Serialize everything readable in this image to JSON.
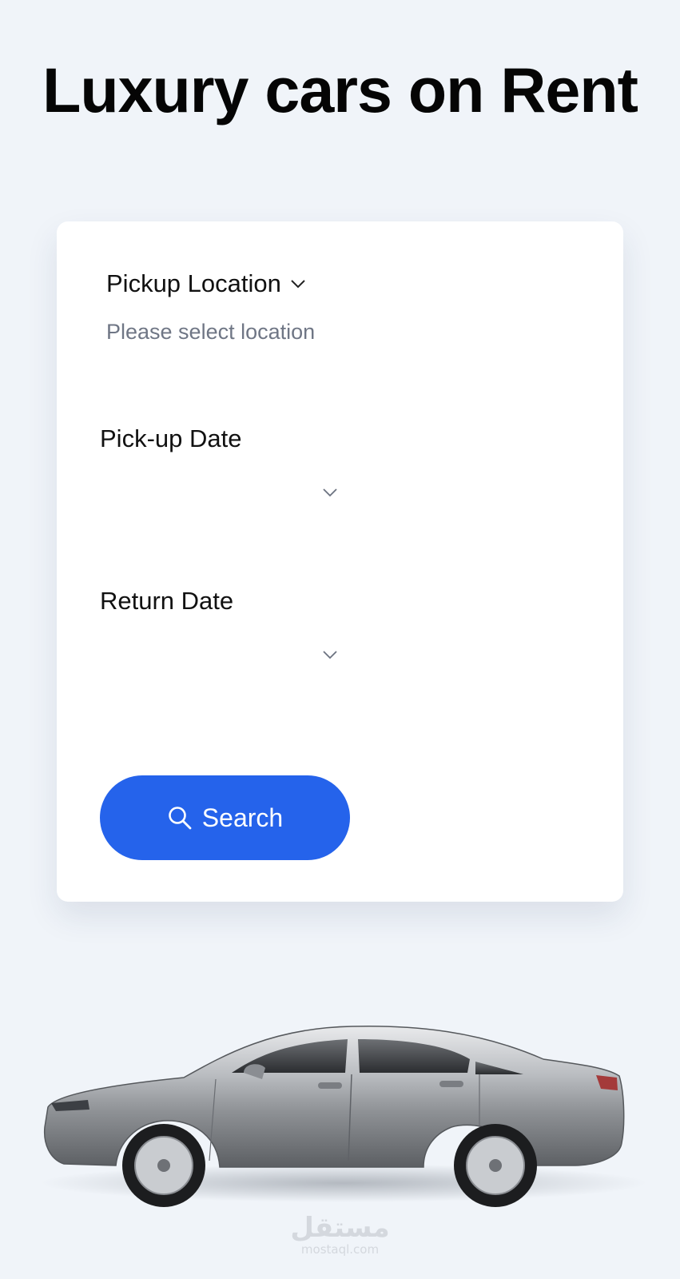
{
  "header": {
    "title": "Luxury cars on Rent"
  },
  "form": {
    "pickup_location": {
      "label": "Pickup Location",
      "placeholder": "Please select location",
      "icon": "chevron-down-icon"
    },
    "pickup_date": {
      "label": "Pick-up Date",
      "icon": "chevron-down-icon"
    },
    "return_date": {
      "label": "Return Date",
      "icon": "chevron-down-icon"
    },
    "search_button": {
      "label": "Search",
      "icon": "search-icon"
    }
  },
  "hero_image": {
    "subject": "silver sedan side view"
  },
  "watermark": {
    "arabic": "مستقل",
    "latin": "mostaql.com"
  },
  "colors": {
    "background": "#f0f4f9",
    "card": "#ffffff",
    "accent": "#2563eb",
    "placeholder": "#6f7685"
  }
}
